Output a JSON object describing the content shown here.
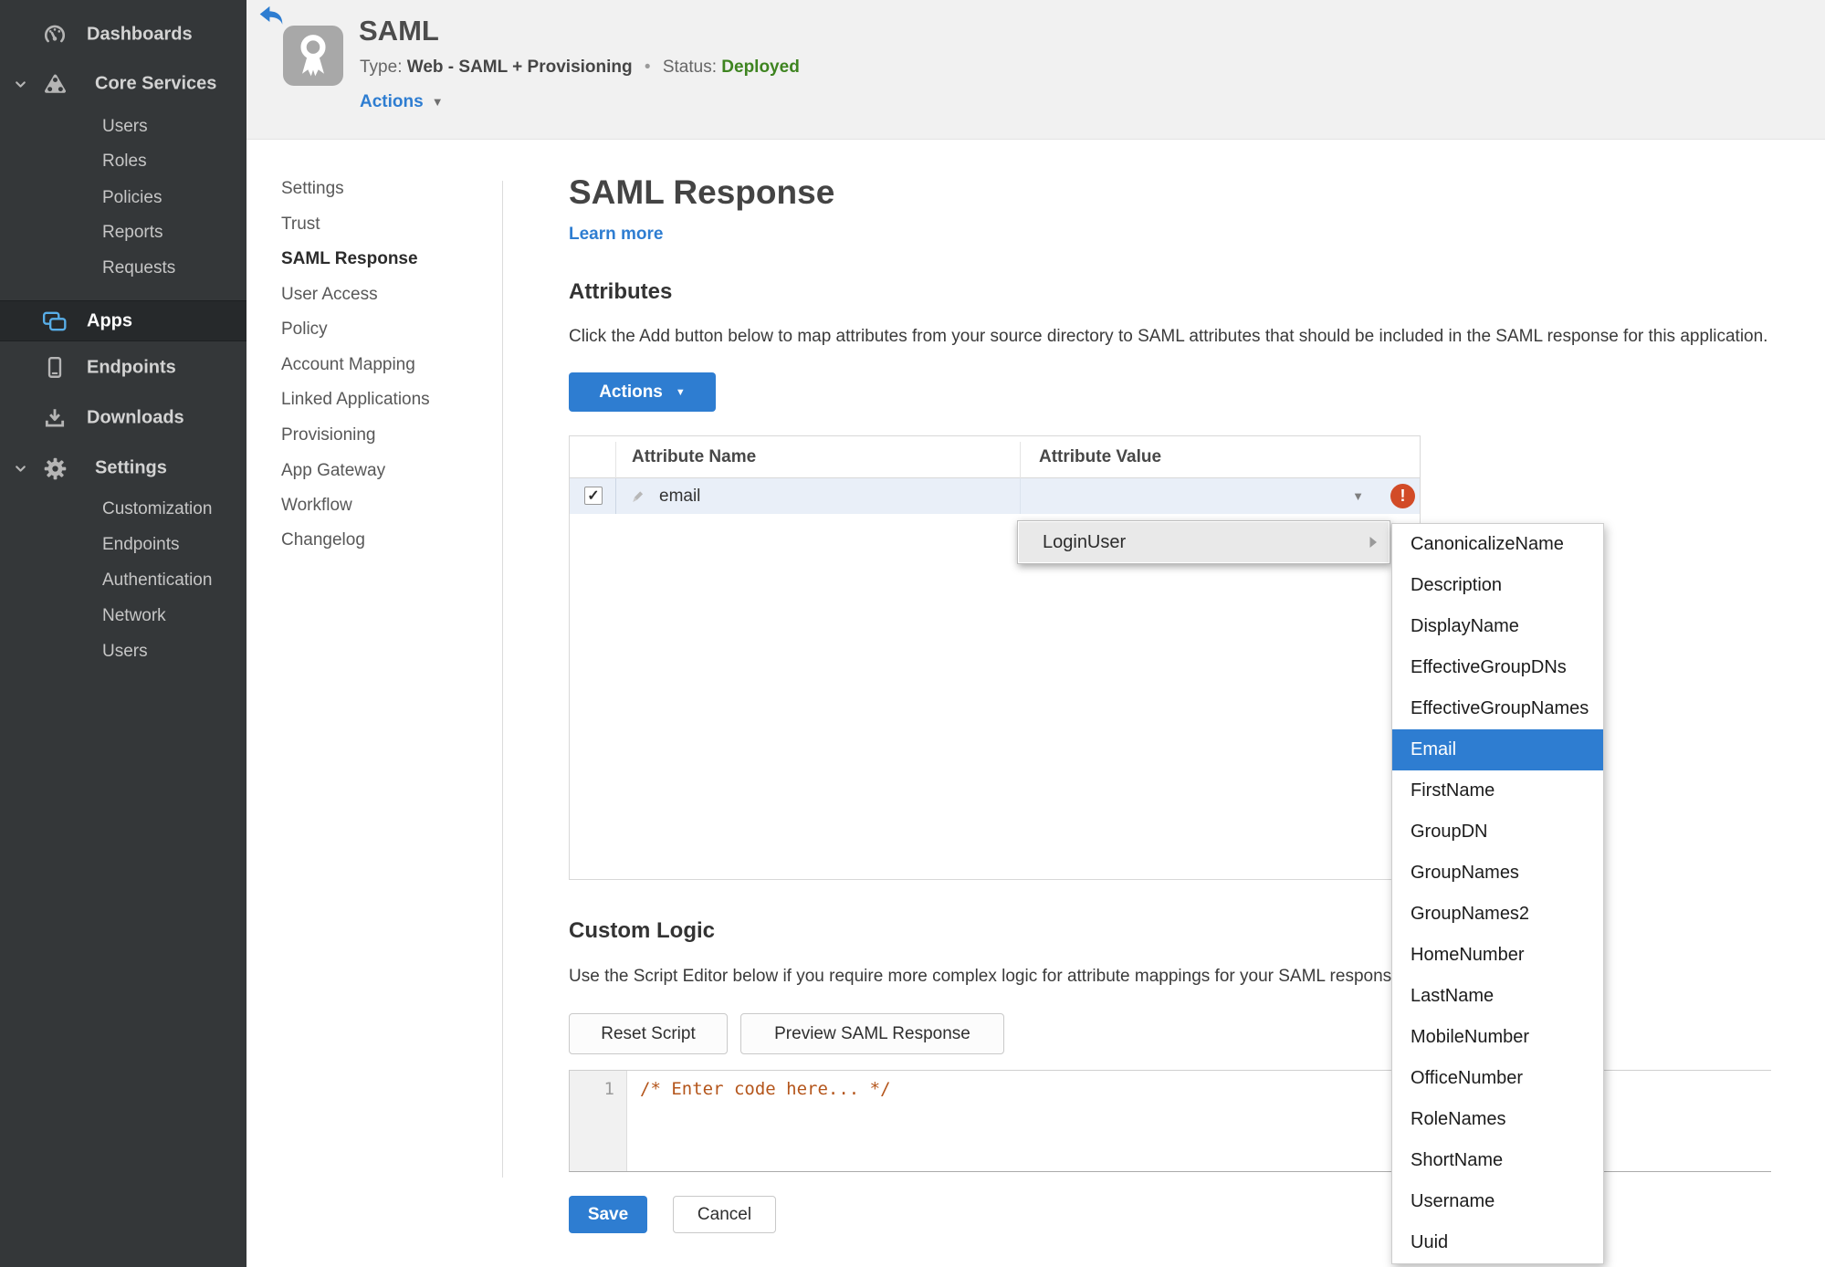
{
  "colors": {
    "accent_blue": "#2e7dd1",
    "status_green": "#3e8420",
    "error_red": "#d24b27",
    "apps_icon_blue": "#58aee8",
    "sidebar_bg": "#343739"
  },
  "icons": {
    "caret_down": "▼",
    "check": "✓",
    "exclamation": "!",
    "bullet": "•"
  },
  "sidebar": {
    "dashboards": "Dashboards",
    "core_services": "Core Services",
    "core_items": [
      "Users",
      "Roles",
      "Policies",
      "Reports",
      "Requests"
    ],
    "apps": "Apps",
    "endpoints": "Endpoints",
    "downloads": "Downloads",
    "settings": "Settings",
    "settings_items": [
      "Customization",
      "Endpoints",
      "Authentication",
      "Network",
      "Users"
    ]
  },
  "header": {
    "title": "SAML",
    "type_label": "Type:",
    "type_value": "Web - SAML + Provisioning",
    "status_label": "Status:",
    "status_value": "Deployed",
    "actions_label": "Actions"
  },
  "subnav": {
    "items": [
      "Settings",
      "Trust",
      "SAML Response",
      "User Access",
      "Policy",
      "Account Mapping",
      "Linked Applications",
      "Provisioning",
      "App Gateway",
      "Workflow",
      "Changelog"
    ],
    "active": "SAML Response"
  },
  "main": {
    "title": "SAML Response",
    "learn_more": "Learn more",
    "attributes": {
      "heading": "Attributes",
      "description": "Click the Add button below to map attributes from your source directory to SAML attributes that should be included in the SAML response for this application.",
      "actions_label": "Actions",
      "table": {
        "col_name": "Attribute Name",
        "col_value": "Attribute Value",
        "row": {
          "name": "email",
          "value": "",
          "checked": true,
          "error": true
        }
      }
    },
    "dropdown": {
      "label": "LoginUser",
      "submenu": [
        "CanonicalizeName",
        "Description",
        "DisplayName",
        "EffectiveGroupDNs",
        "EffectiveGroupNames",
        "Email",
        "FirstName",
        "GroupDN",
        "GroupNames",
        "GroupNames2",
        "HomeNumber",
        "LastName",
        "MobileNumber",
        "OfficeNumber",
        "RoleNames",
        "ShortName",
        "Username",
        "Uuid"
      ],
      "selected": "Email"
    },
    "custom_logic": {
      "heading": "Custom Logic",
      "description": "Use the Script Editor below if you require more complex logic for attribute mappings for your SAML response.",
      "reset_label": "Reset Script",
      "preview_label": "Preview SAML Response",
      "editor": {
        "line_number": "1",
        "code": "/* Enter code here... */"
      }
    },
    "save_label": "Save",
    "cancel_label": "Cancel"
  }
}
